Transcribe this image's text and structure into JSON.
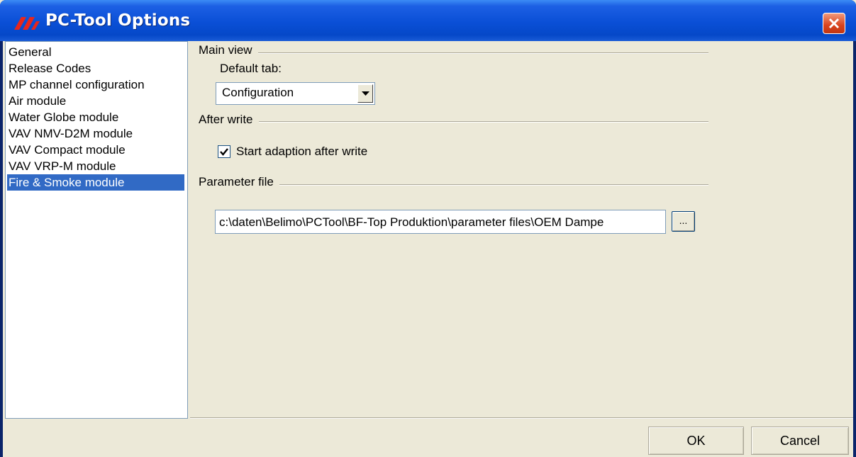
{
  "window": {
    "title": "PC-Tool Options",
    "app_icon": "belimo-logo-icon",
    "close_icon": "close-icon"
  },
  "nav": {
    "items": [
      {
        "label": "General",
        "selected": false
      },
      {
        "label": "Release Codes",
        "selected": false
      },
      {
        "label": "MP channel configuration",
        "selected": false
      },
      {
        "label": "Air module",
        "selected": false
      },
      {
        "label": "Water Globe module",
        "selected": false
      },
      {
        "label": "VAV NMV-D2M module",
        "selected": false
      },
      {
        "label": "VAV Compact module",
        "selected": false
      },
      {
        "label": "VAV VRP-M module",
        "selected": false
      },
      {
        "label": "Fire & Smoke module",
        "selected": true
      }
    ]
  },
  "main_view": {
    "heading": "Main view",
    "default_tab_label": "Default tab:",
    "default_tab_value": "Configuration",
    "dropdown_icon": "chevron-down-icon"
  },
  "after_write": {
    "heading": "After write",
    "checkbox_label": "Start adaption after write",
    "checked": true
  },
  "parameter_file": {
    "heading": "Parameter file",
    "path_value": "c:\\daten\\Belimo\\PCTool\\BF-Top Produktion\\parameter files\\OEM Dampe",
    "browse_label": "..."
  },
  "footer": {
    "ok_label": "OK",
    "cancel_label": "Cancel"
  },
  "colors": {
    "titlebar": "#0a4fd6",
    "selection": "#316ac5",
    "dialog_bg": "#ece9d8",
    "close_button": "#d8431d"
  }
}
